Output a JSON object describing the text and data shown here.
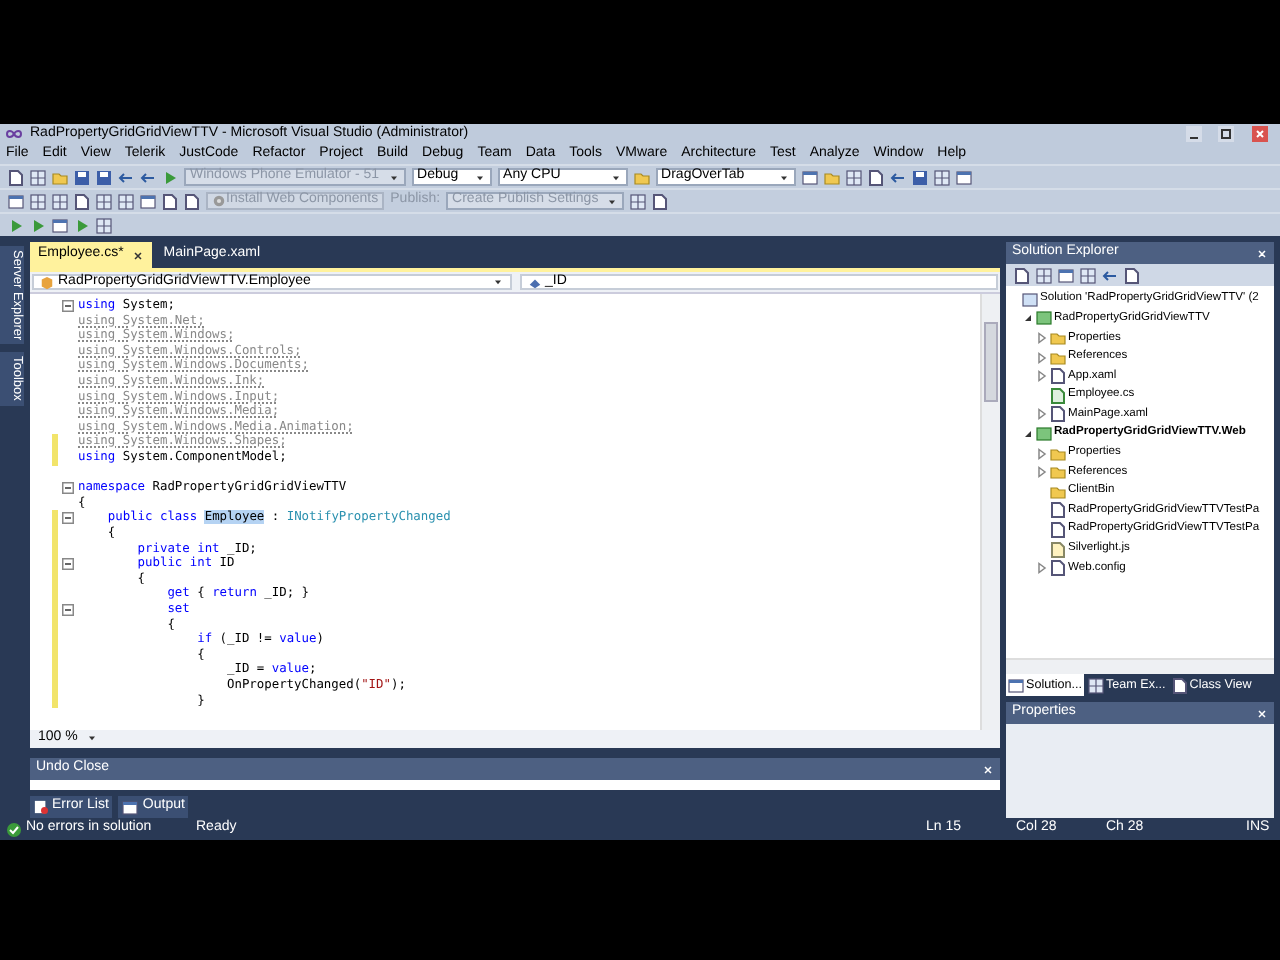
{
  "window": {
    "title": "RadPropertyGridGridViewTTV - Microsoft Visual Studio (Administrator)"
  },
  "menu": [
    "File",
    "Edit",
    "View",
    "Telerik",
    "JustCode",
    "Refactor",
    "Project",
    "Build",
    "Debug",
    "Team",
    "Data",
    "Tools",
    "VMware",
    "Architecture",
    "Test",
    "Analyze",
    "Window",
    "Help"
  ],
  "toolbars": [
    [
      {
        "kind": "combo",
        "value": "Windows Phone Emulator - 51",
        "disabled": true
      },
      {
        "kind": "combo",
        "value": "Debug",
        "disabled": false
      },
      {
        "kind": "combo",
        "value": "Any CPU",
        "disabled": false
      },
      {
        "kind": "combo",
        "value": "DragOverTab",
        "disabled": false
      }
    ],
    [
      {
        "kind": "button",
        "value": "Install Web Components",
        "disabled": true
      },
      {
        "kind": "label",
        "value": "Publish:",
        "disabled": true
      },
      {
        "kind": "combo",
        "value": "Create Publish Settings",
        "disabled": true
      }
    ]
  ],
  "side_tabs": [
    "Server Explorer",
    "Toolbox"
  ],
  "editor_tabs": [
    {
      "label": "Employee.cs*",
      "selected": true
    },
    {
      "label": "MainPage.xaml",
      "selected": false
    }
  ],
  "navigation": {
    "type": "RadPropertyGridGridViewTTV.Employee",
    "member": "_ID"
  },
  "code": [
    {
      "changed": false,
      "collapsible": true,
      "segments": [
        {
          "kind": "keyword",
          "text": "using"
        },
        {
          "kind": "text",
          "text": " System;"
        }
      ]
    },
    {
      "changed": false,
      "collapsible": false,
      "segments": [
        {
          "kind": "unused",
          "text": "using System.Net;"
        }
      ]
    },
    {
      "changed": false,
      "collapsible": false,
      "segments": [
        {
          "kind": "unused",
          "text": "using System.Windows;"
        }
      ]
    },
    {
      "changed": false,
      "collapsible": false,
      "segments": [
        {
          "kind": "unused",
          "text": "using System.Windows.Controls;"
        }
      ]
    },
    {
      "changed": false,
      "collapsible": false,
      "segments": [
        {
          "kind": "unused",
          "text": "using System.Windows.Documents;"
        }
      ]
    },
    {
      "changed": false,
      "collapsible": false,
      "segments": [
        {
          "kind": "unused",
          "text": "using System.Windows.Ink;"
        }
      ]
    },
    {
      "changed": false,
      "collapsible": false,
      "segments": [
        {
          "kind": "unused",
          "text": "using System.Windows.Input;"
        }
      ]
    },
    {
      "changed": false,
      "collapsible": false,
      "segments": [
        {
          "kind": "unused",
          "text": "using System.Windows.Media;"
        }
      ]
    },
    {
      "changed": false,
      "collapsible": false,
      "segments": [
        {
          "kind": "unused",
          "text": "using System.Windows.Media.Animation;"
        }
      ]
    },
    {
      "changed": true,
      "collapsible": false,
      "segments": [
        {
          "kind": "unused",
          "text": "using System.Windows.Shapes;"
        }
      ]
    },
    {
      "changed": true,
      "collapsible": false,
      "segments": [
        {
          "kind": "keyword",
          "text": "using"
        },
        {
          "kind": "text",
          "text": " System.ComponentModel;"
        }
      ]
    },
    {
      "changed": false,
      "collapsible": true,
      "blank_before": true,
      "segments": [
        {
          "kind": "keyword",
          "text": "namespace"
        },
        {
          "kind": "text",
          "text": " RadPropertyGridGridViewTTV"
        }
      ]
    },
    {
      "changed": false,
      "collapsible": false,
      "segments": [
        {
          "kind": "text",
          "text": "{"
        }
      ]
    },
    {
      "changed": true,
      "collapsible": true,
      "segments": [
        {
          "kind": "keyword",
          "text": "    public class "
        },
        {
          "kind": "highlight",
          "text": "Employee"
        },
        {
          "kind": "text",
          "text": " : "
        },
        {
          "kind": "type",
          "text": "INotifyPropertyChanged"
        }
      ]
    },
    {
      "changed": true,
      "collapsible": false,
      "segments": [
        {
          "kind": "text",
          "text": "    {"
        }
      ]
    },
    {
      "changed": true,
      "collapsible": false,
      "segments": [
        {
          "kind": "keyword",
          "text": "        private int"
        },
        {
          "kind": "text",
          "text": " _ID;"
        }
      ]
    },
    {
      "changed": true,
      "collapsible": true,
      "segments": [
        {
          "kind": "keyword",
          "text": "        public int"
        },
        {
          "kind": "text",
          "text": " ID"
        }
      ]
    },
    {
      "changed": true,
      "collapsible": false,
      "segments": [
        {
          "kind": "text",
          "text": "        {"
        }
      ]
    },
    {
      "changed": true,
      "collapsible": false,
      "segments": [
        {
          "kind": "keyword",
          "text": "            get"
        },
        {
          "kind": "text",
          "text": " { "
        },
        {
          "kind": "keyword",
          "text": "return"
        },
        {
          "kind": "text",
          "text": " _ID; }"
        }
      ]
    },
    {
      "changed": true,
      "collapsible": true,
      "segments": [
        {
          "kind": "keyword",
          "text": "            set"
        }
      ]
    },
    {
      "changed": true,
      "collapsible": false,
      "segments": [
        {
          "kind": "text",
          "text": "            {"
        }
      ]
    },
    {
      "changed": true,
      "collapsible": false,
      "segments": [
        {
          "kind": "keyword",
          "text": "                if"
        },
        {
          "kind": "text",
          "text": " (_ID != "
        },
        {
          "kind": "keyword",
          "text": "value"
        },
        {
          "kind": "text",
          "text": ")"
        }
      ]
    },
    {
      "changed": true,
      "collapsible": false,
      "segments": [
        {
          "kind": "text",
          "text": "                {"
        }
      ]
    },
    {
      "changed": true,
      "collapsible": false,
      "segments": [
        {
          "kind": "text",
          "text": "                    _ID = "
        },
        {
          "kind": "keyword",
          "text": "value"
        },
        {
          "kind": "text",
          "text": ";"
        }
      ]
    },
    {
      "changed": true,
      "collapsible": false,
      "segments": [
        {
          "kind": "text",
          "text": "                    OnPropertyChanged("
        },
        {
          "kind": "string",
          "text": "\"ID\""
        },
        {
          "kind": "text",
          "text": ");"
        }
      ]
    },
    {
      "changed": true,
      "collapsible": false,
      "segments": [
        {
          "kind": "text",
          "text": "                }"
        }
      ]
    }
  ],
  "zoom": "100 %",
  "solution_explorer": {
    "title": "Solution Explorer",
    "tree": [
      {
        "label": "Solution 'RadPropertyGridGridViewTTV' (2",
        "kind": "solution",
        "bold": false,
        "children": [
          {
            "label": "RadPropertyGridGridViewTTV",
            "kind": "project",
            "bold": false,
            "expanded": true,
            "children": [
              {
                "label": "Properties",
                "kind": "properties",
                "bold": false,
                "expanded": false
              },
              {
                "label": "References",
                "kind": "references",
                "bold": false,
                "expanded": false
              },
              {
                "label": "App.xaml",
                "kind": "xaml",
                "bold": false,
                "expanded": false
              },
              {
                "label": "Employee.cs",
                "kind": "csharp",
                "bold": false
              },
              {
                "label": "MainPage.xaml",
                "kind": "xaml",
                "bold": false,
                "expanded": false
              }
            ]
          },
          {
            "label": "RadPropertyGridGridViewTTV.Web",
            "kind": "project",
            "bold": true,
            "expanded": true,
            "children": [
              {
                "label": "Properties",
                "kind": "properties",
                "bold": false,
                "expanded": false
              },
              {
                "label": "References",
                "kind": "references",
                "bold": false,
                "expanded": false
              },
              {
                "label": "ClientBin",
                "kind": "folder",
                "bold": false
              },
              {
                "label": "RadPropertyGridGridViewTTVTestPa",
                "kind": "page",
                "bold": false
              },
              {
                "label": "RadPropertyGridGridViewTTVTestPa",
                "kind": "page",
                "bold": false
              },
              {
                "label": "Silverlight.js",
                "kind": "script",
                "bold": false
              },
              {
                "label": "Web.config",
                "kind": "config",
                "bold": false,
                "expanded": false
              }
            ]
          }
        ]
      }
    ],
    "tabs": [
      {
        "label": "Solution...",
        "selected": true
      },
      {
        "label": "Team Ex...",
        "selected": false
      },
      {
        "label": "Class View",
        "selected": false
      }
    ]
  },
  "properties": {
    "title": "Properties"
  },
  "undo_close": {
    "title": "Undo Close"
  },
  "bottom_tabs": [
    "Error List",
    "Output"
  ],
  "status_bar": {
    "message": "No errors in solution",
    "state": "Ready",
    "line": "Ln 15",
    "column": "Col 28",
    "char": "Ch 28",
    "mode": "INS"
  }
}
